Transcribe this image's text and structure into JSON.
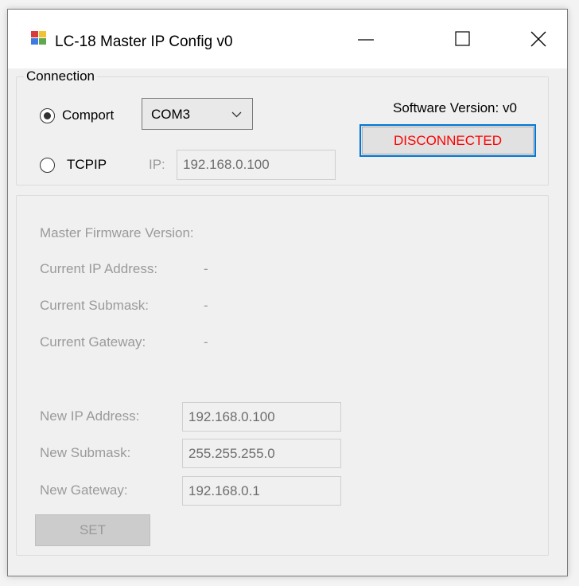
{
  "window": {
    "title": "LC-18 Master IP Config v0",
    "controls": [
      "minimize",
      "maximize",
      "close"
    ]
  },
  "connection": {
    "legend": "Connection",
    "comport_label": "Comport",
    "comport_selected": true,
    "com_port_value": "COM3",
    "tcpip_label": "TCPIP",
    "tcpip_selected": false,
    "ip_label": "IP:",
    "ip_value": "192.168.0.100"
  },
  "status": {
    "software_version": "Software Version: v0",
    "connection_state": "DISCONNECTED",
    "connection_state_color": "#ff0000"
  },
  "config": {
    "master_firmware_label": "Master Firmware Version:",
    "current_ip_label": "Current IP Address:",
    "current_ip_value": "-",
    "current_submask_label": "Current Submask:",
    "current_submask_value": "-",
    "current_gateway_label": "Current Gateway:",
    "current_gateway_value": "-",
    "new_ip_label": "New IP Address:",
    "new_ip_value": "192.168.0.100",
    "new_submask_label": "New Submask:",
    "new_submask_value": "255.255.255.0",
    "new_gateway_label": "New Gateway:",
    "new_gateway_value": "192.168.0.1",
    "set_label": "SET"
  },
  "icons": {
    "app": "app-icon",
    "combo": "chevron-down-icon"
  }
}
